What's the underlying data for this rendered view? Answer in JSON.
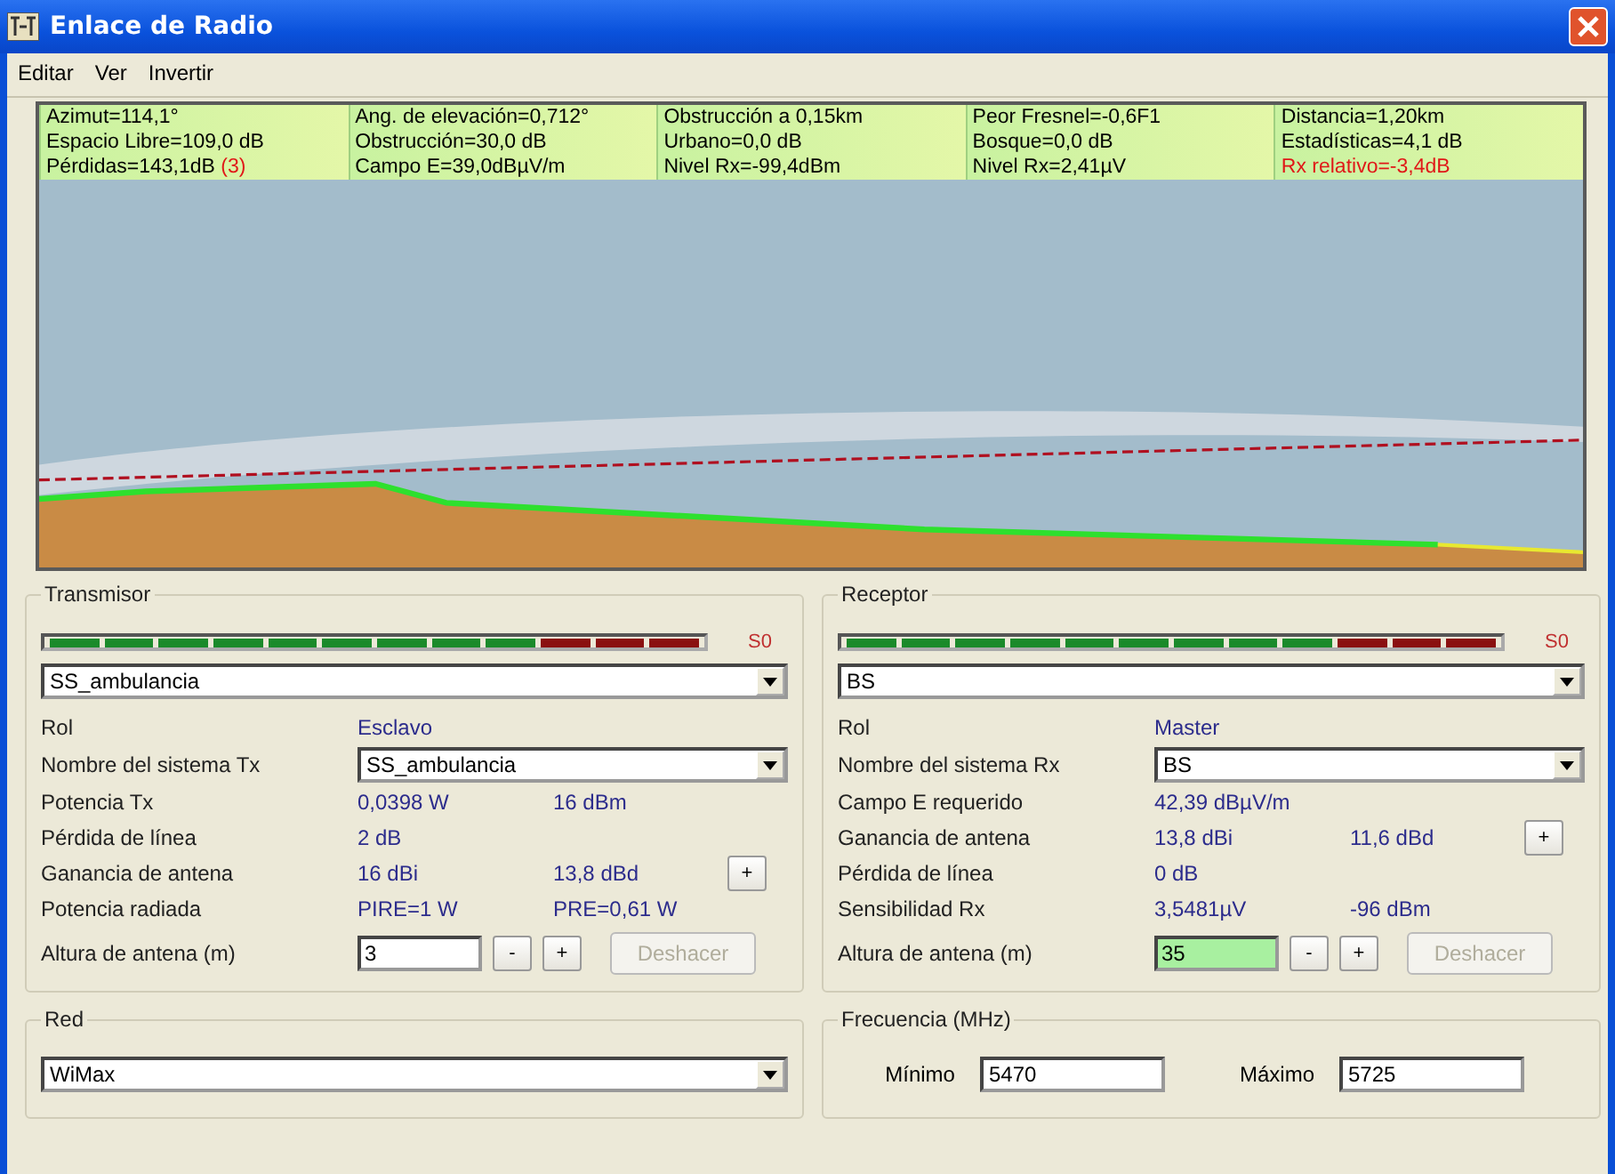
{
  "window": {
    "title": "Enlace de Radio"
  },
  "menu": [
    "Editar",
    "Ver",
    "Invertir"
  ],
  "info": [
    [
      {
        "text": "Azimut=114,1°",
        "alert": false
      },
      {
        "text": "Ang. de elevación=0,712°",
        "alert": false
      },
      {
        "text": "Obstrucción a 0,15km",
        "alert": false
      },
      {
        "text": "Peor Fresnel=-0,6F1",
        "alert": false
      },
      {
        "text": "Distancia=1,20km",
        "alert": false
      }
    ],
    [
      {
        "text": "Espacio Libre=109,0 dB",
        "alert": false
      },
      {
        "text": "Obstrucción=30,0 dB",
        "alert": false
      },
      {
        "text": "Urbano=0,0 dB",
        "alert": false
      },
      {
        "text": "Bosque=0,0 dB",
        "alert": false
      },
      {
        "text": "Estadísticas=4,1 dB",
        "alert": false
      }
    ],
    [
      {
        "text": "Pérdidas=143,1dB",
        "note": "(3)",
        "alert": false
      },
      {
        "text": "Campo E=39,0dBµV/m",
        "alert": false
      },
      {
        "text": "Nivel Rx=-99,4dBm",
        "alert": false
      },
      {
        "text": "Nivel Rx=2,41µV",
        "alert": false
      },
      {
        "text": "Rx relativo=-3,4dB",
        "alert": true
      }
    ]
  ],
  "panels": [
    {
      "title": "Transmisor",
      "meter": {
        "level": 0.75,
        "reading": "S0"
      },
      "station": "SS_ambulancia",
      "rows": [
        {
          "kind": "value",
          "label": "Rol",
          "values": [
            "Esclavo"
          ]
        },
        {
          "kind": "select",
          "label": "Nombre del sistema Tx",
          "value": "SS_ambulancia"
        },
        {
          "kind": "value",
          "label": "Potencia Tx",
          "values": [
            "0,0398 W",
            "16 dBm"
          ]
        },
        {
          "kind": "value",
          "label": "Pérdida de línea",
          "values": [
            "2 dB"
          ]
        },
        {
          "kind": "value",
          "label": "Ganancia de antena",
          "values": [
            "16 dBi",
            "13,8 dBd"
          ],
          "button": "+"
        },
        {
          "kind": "value",
          "label": "Potencia radiada",
          "values": [
            "PIRE=1 W",
            "PRE=0,61 W"
          ]
        },
        {
          "kind": "height",
          "label": "Altura de antena (m)",
          "value": "3",
          "highlighted": false,
          "buttons": [
            "-",
            "+"
          ],
          "undo": "Deshacer",
          "undo_disabled": true
        }
      ]
    },
    {
      "title": "Receptor",
      "meter": {
        "level": 0.75,
        "reading": "S0"
      },
      "station": "BS",
      "rows": [
        {
          "kind": "value",
          "label": "Rol",
          "values": [
            "Master"
          ]
        },
        {
          "kind": "select",
          "label": "Nombre del sistema Rx",
          "value": "BS"
        },
        {
          "kind": "value",
          "label": "Campo E requerido",
          "values": [
            "42,39 dBµV/m"
          ]
        },
        {
          "kind": "value",
          "label": "Ganancia de antena",
          "values": [
            "13,8 dBi",
            "11,6 dBd"
          ],
          "button": "+"
        },
        {
          "kind": "value",
          "label": "Pérdida de línea",
          "values": [
            "0 dB"
          ]
        },
        {
          "kind": "value",
          "label": "Sensibilidad Rx",
          "values": [
            "3,5481µV",
            "-96 dBm"
          ]
        },
        {
          "kind": "height",
          "label": "Altura de antena (m)",
          "value": "35",
          "highlighted": true,
          "buttons": [
            "-",
            "+"
          ],
          "undo": "Deshacer",
          "undo_disabled": true
        }
      ]
    }
  ],
  "network": {
    "title": "Red",
    "value": "WiMax"
  },
  "frequency": {
    "title": "Frecuencia (MHz)",
    "fields": [
      {
        "label": "Mínimo",
        "value": "5470"
      },
      {
        "label": "Máximo",
        "value": "5725"
      }
    ]
  }
}
